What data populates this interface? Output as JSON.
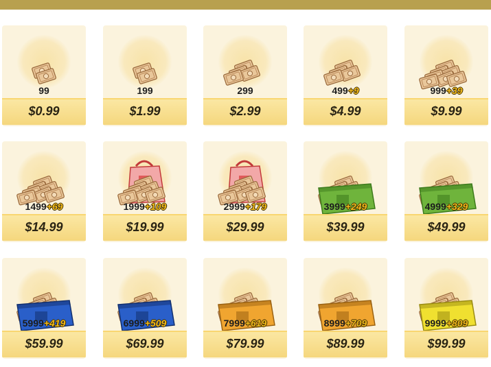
{
  "colors": {
    "card_bg": "#fbf3dd",
    "price_bar": "#f5d77e",
    "bonus_text": "#f3bb1d",
    "top_bar": "#b8a04f"
  },
  "packs": [
    {
      "amount": "99",
      "bonus": "",
      "price": "$0.99",
      "icon": "cash-small-icon"
    },
    {
      "amount": "199",
      "bonus": "",
      "price": "$1.99",
      "icon": "cash-small-icon"
    },
    {
      "amount": "299",
      "bonus": "",
      "price": "$2.99",
      "icon": "cash-stack-icon"
    },
    {
      "amount": "499",
      "bonus": "+9",
      "price": "$4.99",
      "icon": "cash-stack-icon"
    },
    {
      "amount": "999",
      "bonus": "+39",
      "price": "$9.99",
      "icon": "cash-pile-icon"
    },
    {
      "amount": "1499",
      "bonus": "+69",
      "price": "$14.99",
      "icon": "cash-pile-icon"
    },
    {
      "amount": "1999",
      "bonus": "+109",
      "price": "$19.99",
      "icon": "cash-bag-icon"
    },
    {
      "amount": "2999",
      "bonus": "+179",
      "price": "$29.99",
      "icon": "cash-bag-icon"
    },
    {
      "amount": "3999",
      "bonus": "+249",
      "price": "$39.99",
      "icon": "green-cash-box-icon"
    },
    {
      "amount": "4999",
      "bonus": "+329",
      "price": "$49.99",
      "icon": "green-cash-box-icon"
    },
    {
      "amount": "5999",
      "bonus": "+419",
      "price": "$59.99",
      "icon": "blue-cash-crate-icon"
    },
    {
      "amount": "6999",
      "bonus": "+509",
      "price": "$69.99",
      "icon": "blue-cash-crate-icon"
    },
    {
      "amount": "7999",
      "bonus": "+619",
      "price": "$79.99",
      "icon": "orange-cash-crate-icon"
    },
    {
      "amount": "8999",
      "bonus": "+709",
      "price": "$89.99",
      "icon": "orange-cash-crate-icon"
    },
    {
      "amount": "9999",
      "bonus": "+809",
      "price": "$99.99",
      "icon": "yellow-cash-crate-icon"
    }
  ]
}
